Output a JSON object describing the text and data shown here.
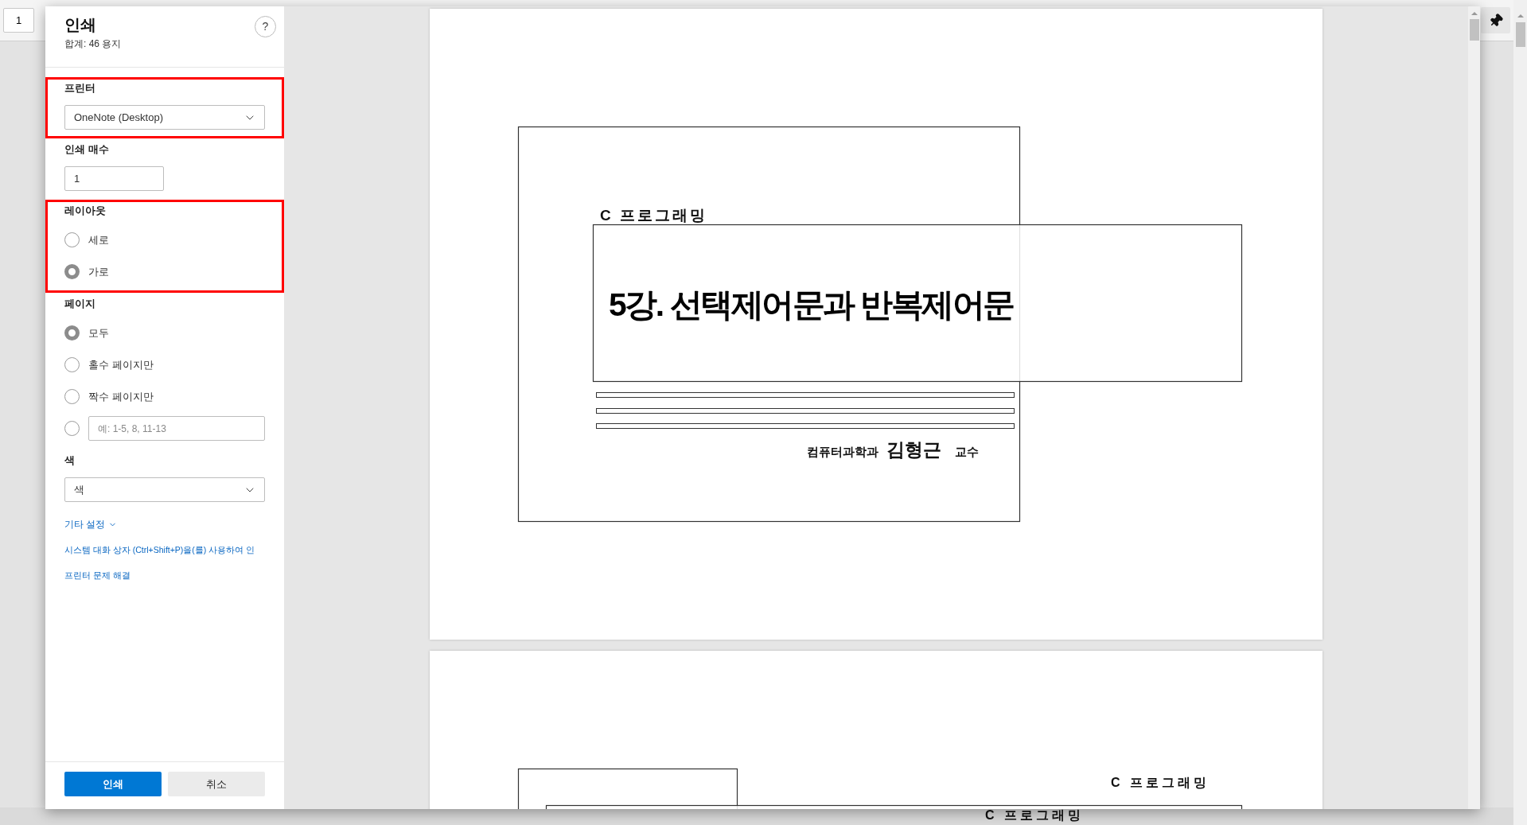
{
  "app": {
    "page_number": "1",
    "footer_text": "C 프로그래밍"
  },
  "dialog": {
    "title": "인쇄",
    "subtitle": "합계: 46 용지",
    "help": "?",
    "sections": [
      {
        "kind": "select",
        "label": "프린터",
        "value": "OneNote (Desktop)",
        "highlighted": true
      },
      {
        "kind": "number",
        "label": "인쇄 매수",
        "value": "1",
        "highlighted": false
      },
      {
        "kind": "radios",
        "label": "레이아웃",
        "highlighted": true,
        "options": [
          {
            "label": "세로",
            "selected": false
          },
          {
            "label": "가로",
            "selected": true
          }
        ]
      },
      {
        "kind": "radios",
        "label": "페이지",
        "highlighted": false,
        "options": [
          {
            "label": "모두",
            "selected": true
          },
          {
            "label": "홀수 페이지만",
            "selected": false
          },
          {
            "label": "짝수 페이지만",
            "selected": false
          },
          {
            "placeholder": "예: 1-5, 8, 11-13",
            "selected": false
          }
        ]
      },
      {
        "kind": "select",
        "label": "색",
        "value": "색",
        "highlighted": false
      }
    ],
    "more_settings": "기타 설정",
    "links": [
      "시스템 대화 상자 (Ctrl+Shift+P)을(를) 사용하여 인",
      "프린터 문제 해결"
    ],
    "buttons": [
      {
        "label": "인쇄",
        "kind": "primary"
      },
      {
        "label": "취소",
        "kind": "secondary"
      }
    ]
  },
  "preview": {
    "pages": [
      {
        "kind": "title",
        "header": "C 프로그래밍",
        "title": "5강. 선택제어문과 반복제어문",
        "author_dept": "컴퓨터과학과",
        "author_name": "김형근",
        "author_title": "교수"
      },
      {
        "kind": "partial",
        "header": "C 프로그래밍"
      }
    ]
  }
}
